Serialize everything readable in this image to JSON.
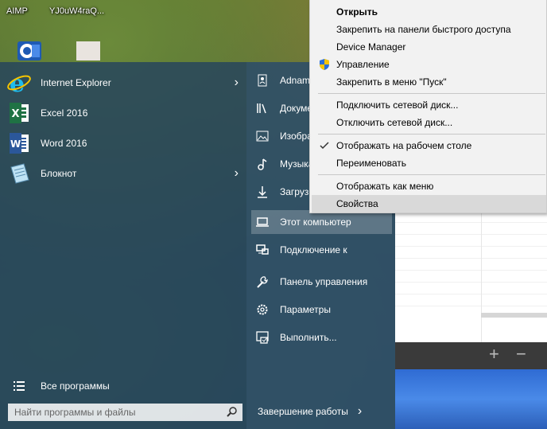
{
  "desktop": {
    "icons": [
      {
        "label": "AIMP"
      },
      {
        "label": "YJ0uW4raQ..."
      }
    ]
  },
  "start_menu": {
    "apps": [
      {
        "label": "Internet Explorer",
        "icon": "internet-explorer-icon",
        "has_submenu": true
      },
      {
        "label": "Excel 2016",
        "icon": "excel-icon",
        "has_submenu": false
      },
      {
        "label": "Word 2016",
        "icon": "word-icon",
        "has_submenu": false
      },
      {
        "label": "Блокнот",
        "icon": "notepad-icon",
        "has_submenu": true
      }
    ],
    "all_programs": "Все программы",
    "search_placeholder": "Найти программы и файлы",
    "right_items": [
      {
        "label": "Adnam",
        "icon": "user-folder-icon"
      },
      {
        "label": "Докуме",
        "icon": "documents-icon"
      },
      {
        "label": "Изобра",
        "icon": "pictures-icon"
      },
      {
        "label": "Музыка",
        "icon": "music-icon"
      },
      {
        "label": "Загрузк",
        "icon": "downloads-icon"
      },
      {
        "label": "Этот компьютер",
        "icon": "computer-icon",
        "selected": true
      },
      {
        "label": "Подключение к",
        "icon": "connect-icon"
      },
      {
        "label": "Панель управления",
        "icon": "control-panel-icon"
      },
      {
        "label": "Параметры",
        "icon": "settings-gear-icon"
      },
      {
        "label": "Выполнить...",
        "icon": "run-icon"
      }
    ],
    "shutdown": "Завершение работы"
  },
  "context_menu": {
    "items": [
      {
        "label": "Открыть",
        "bold": true
      },
      {
        "label": "Закрепить на панели быстрого доступа"
      },
      {
        "label": "Device Manager"
      },
      {
        "label": "Управление",
        "icon": "uac-shield-icon"
      },
      {
        "label": "Закрепить в меню \"Пуск\""
      },
      {
        "label": "Подключить сетевой диск..."
      },
      {
        "label": "Отключить сетевой диск..."
      },
      {
        "label": "Отображать на рабочем столе",
        "checked": true
      },
      {
        "label": "Переименовать"
      },
      {
        "label": "Отображать как меню"
      },
      {
        "label": "Свойства",
        "hover": true
      }
    ]
  },
  "background_window": {
    "buttons": [
      "+",
      "−"
    ]
  },
  "colors": {
    "start_menu_bg": "#28465c",
    "context_menu_bg": "#f2f2f2",
    "excel_green": "#1f7244",
    "word_blue": "#2b579a",
    "ie_blue": "#1ebbee"
  }
}
